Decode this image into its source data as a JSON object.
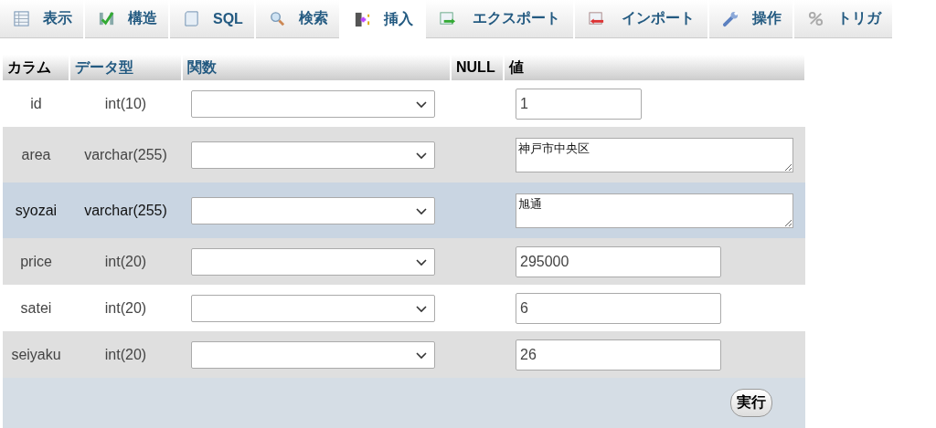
{
  "tabs": [
    {
      "label": "表示",
      "selected": false
    },
    {
      "label": "構造",
      "selected": false
    },
    {
      "label": "SQL",
      "selected": false
    },
    {
      "label": "検索",
      "selected": false
    },
    {
      "label": "挿入",
      "selected": true
    },
    {
      "label": "エクスポート",
      "selected": false
    },
    {
      "label": "インポート",
      "selected": false
    },
    {
      "label": "操作",
      "selected": false
    },
    {
      "label": "トリガ",
      "selected": false
    }
  ],
  "table": {
    "columns": [
      "カラム",
      "データ型",
      "関数",
      "NULL",
      "値"
    ],
    "rows": [
      {
        "column": "id",
        "type": "int(10)",
        "kind": "short-input",
        "value": "1",
        "highlighted": false
      },
      {
        "column": "area",
        "type": "varchar(255)",
        "kind": "textarea",
        "value": "神戸市中央区",
        "highlighted": false
      },
      {
        "column": "syozai",
        "type": "varchar(255)",
        "kind": "textarea",
        "value": "旭通",
        "highlighted": true
      },
      {
        "column": "price",
        "type": "int(20)",
        "kind": "input",
        "value": "295000",
        "highlighted": false
      },
      {
        "column": "satei",
        "type": "int(20)",
        "kind": "input",
        "value": "6",
        "highlighted": false
      },
      {
        "column": "seiyaku",
        "type": "int(20)",
        "kind": "input",
        "value": "26",
        "highlighted": false
      }
    ],
    "submit": "実行"
  }
}
